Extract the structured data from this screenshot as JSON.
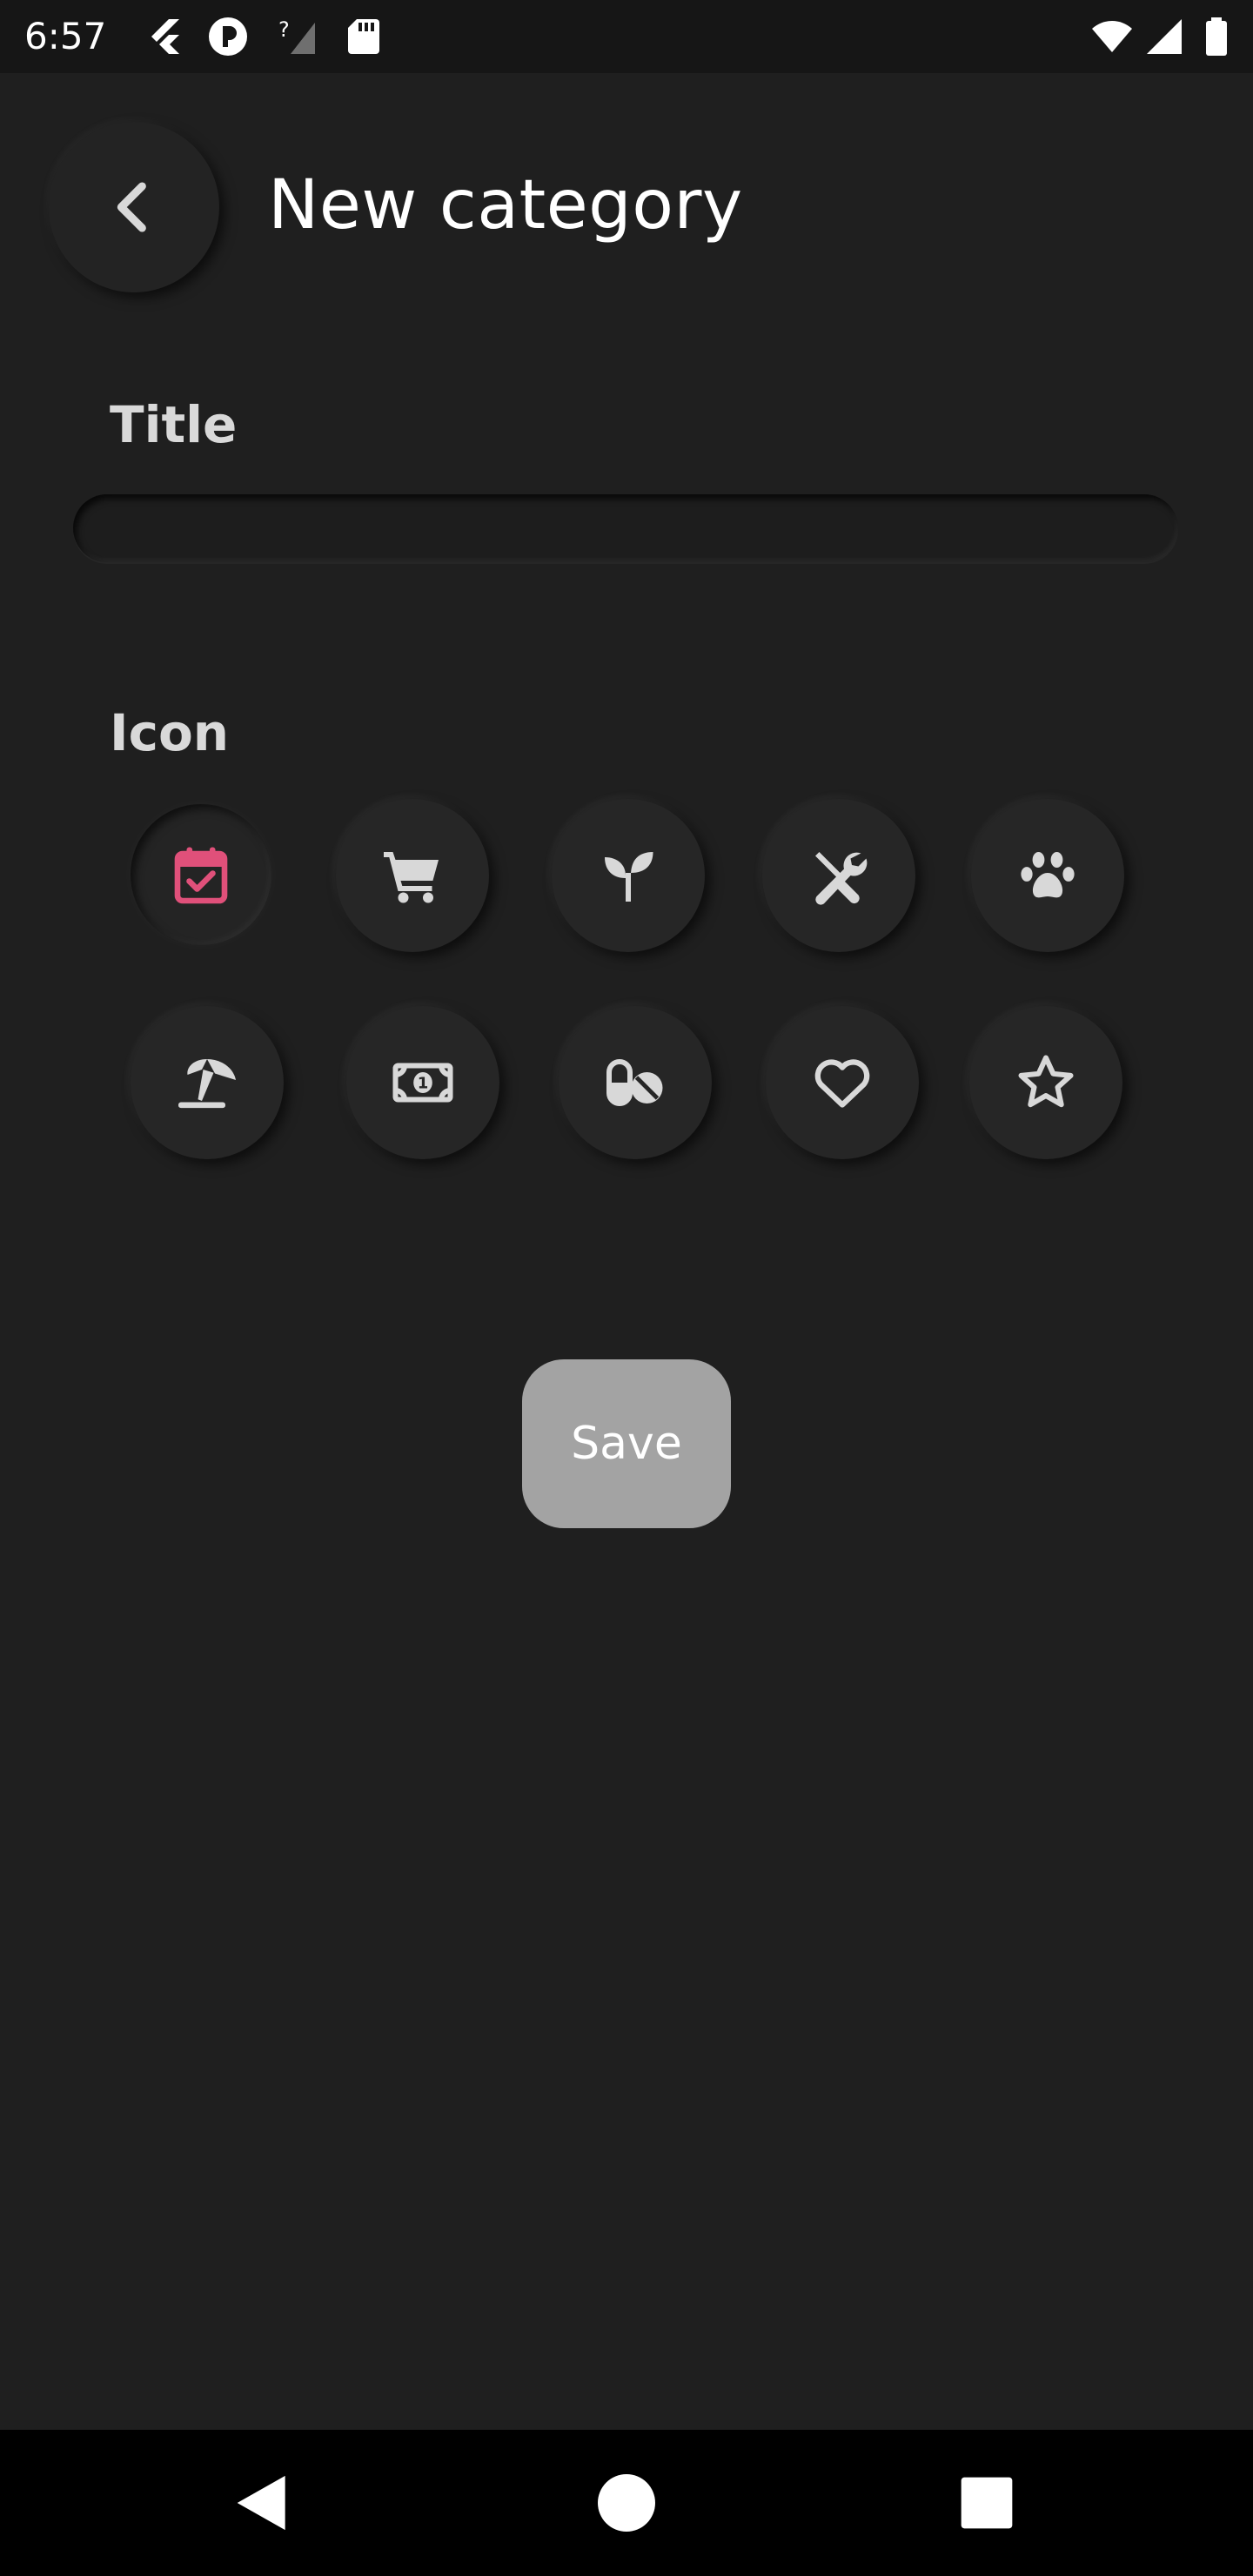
{
  "status_bar": {
    "time": "6:57",
    "icons_left": [
      "flutter-icon",
      "recording-icon",
      "no-signal-icon",
      "sd-card-icon"
    ],
    "icons_right": [
      "wifi-icon",
      "cell-signal-icon",
      "battery-icon"
    ]
  },
  "header": {
    "title": "New category",
    "back_icon": "chevron-left-icon"
  },
  "form": {
    "title_label": "Title",
    "title_value": "",
    "icon_label": "Icon",
    "selected_icon": "calendar-check-icon",
    "selected_color": "#e0507a",
    "icon_color": "#d8d8d8",
    "icons": [
      "calendar-check-icon",
      "shopping-cart-icon",
      "seedling-icon",
      "tools-icon",
      "paw-icon",
      "beach-umbrella-icon",
      "money-bill-icon",
      "pills-icon",
      "heart-icon",
      "star-icon"
    ]
  },
  "actions": {
    "save_label": "Save"
  },
  "nav_bar": {
    "icons": [
      "back-triangle-icon",
      "home-circle-icon",
      "recents-square-icon"
    ]
  }
}
